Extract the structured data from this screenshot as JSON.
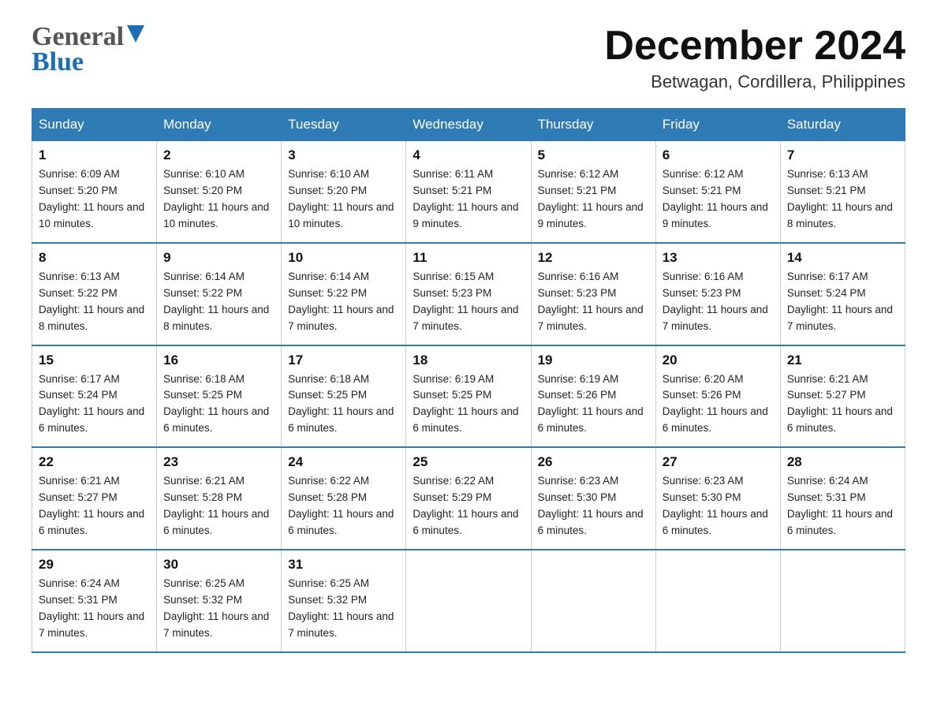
{
  "header": {
    "logo_top": "General",
    "logo_bottom": "Blue",
    "month_title": "December 2024",
    "location": "Betwagan, Cordillera, Philippines"
  },
  "days_of_week": [
    "Sunday",
    "Monday",
    "Tuesday",
    "Wednesday",
    "Thursday",
    "Friday",
    "Saturday"
  ],
  "weeks": [
    [
      {
        "day": "1",
        "sunrise": "6:09 AM",
        "sunset": "5:20 PM",
        "daylight": "11 hours and 10 minutes."
      },
      {
        "day": "2",
        "sunrise": "6:10 AM",
        "sunset": "5:20 PM",
        "daylight": "11 hours and 10 minutes."
      },
      {
        "day": "3",
        "sunrise": "6:10 AM",
        "sunset": "5:20 PM",
        "daylight": "11 hours and 10 minutes."
      },
      {
        "day": "4",
        "sunrise": "6:11 AM",
        "sunset": "5:21 PM",
        "daylight": "11 hours and 9 minutes."
      },
      {
        "day": "5",
        "sunrise": "6:12 AM",
        "sunset": "5:21 PM",
        "daylight": "11 hours and 9 minutes."
      },
      {
        "day": "6",
        "sunrise": "6:12 AM",
        "sunset": "5:21 PM",
        "daylight": "11 hours and 9 minutes."
      },
      {
        "day": "7",
        "sunrise": "6:13 AM",
        "sunset": "5:21 PM",
        "daylight": "11 hours and 8 minutes."
      }
    ],
    [
      {
        "day": "8",
        "sunrise": "6:13 AM",
        "sunset": "5:22 PM",
        "daylight": "11 hours and 8 minutes."
      },
      {
        "day": "9",
        "sunrise": "6:14 AM",
        "sunset": "5:22 PM",
        "daylight": "11 hours and 8 minutes."
      },
      {
        "day": "10",
        "sunrise": "6:14 AM",
        "sunset": "5:22 PM",
        "daylight": "11 hours and 7 minutes."
      },
      {
        "day": "11",
        "sunrise": "6:15 AM",
        "sunset": "5:23 PM",
        "daylight": "11 hours and 7 minutes."
      },
      {
        "day": "12",
        "sunrise": "6:16 AM",
        "sunset": "5:23 PM",
        "daylight": "11 hours and 7 minutes."
      },
      {
        "day": "13",
        "sunrise": "6:16 AM",
        "sunset": "5:23 PM",
        "daylight": "11 hours and 7 minutes."
      },
      {
        "day": "14",
        "sunrise": "6:17 AM",
        "sunset": "5:24 PM",
        "daylight": "11 hours and 7 minutes."
      }
    ],
    [
      {
        "day": "15",
        "sunrise": "6:17 AM",
        "sunset": "5:24 PM",
        "daylight": "11 hours and 6 minutes."
      },
      {
        "day": "16",
        "sunrise": "6:18 AM",
        "sunset": "5:25 PM",
        "daylight": "11 hours and 6 minutes."
      },
      {
        "day": "17",
        "sunrise": "6:18 AM",
        "sunset": "5:25 PM",
        "daylight": "11 hours and 6 minutes."
      },
      {
        "day": "18",
        "sunrise": "6:19 AM",
        "sunset": "5:25 PM",
        "daylight": "11 hours and 6 minutes."
      },
      {
        "day": "19",
        "sunrise": "6:19 AM",
        "sunset": "5:26 PM",
        "daylight": "11 hours and 6 minutes."
      },
      {
        "day": "20",
        "sunrise": "6:20 AM",
        "sunset": "5:26 PM",
        "daylight": "11 hours and 6 minutes."
      },
      {
        "day": "21",
        "sunrise": "6:21 AM",
        "sunset": "5:27 PM",
        "daylight": "11 hours and 6 minutes."
      }
    ],
    [
      {
        "day": "22",
        "sunrise": "6:21 AM",
        "sunset": "5:27 PM",
        "daylight": "11 hours and 6 minutes."
      },
      {
        "day": "23",
        "sunrise": "6:21 AM",
        "sunset": "5:28 PM",
        "daylight": "11 hours and 6 minutes."
      },
      {
        "day": "24",
        "sunrise": "6:22 AM",
        "sunset": "5:28 PM",
        "daylight": "11 hours and 6 minutes."
      },
      {
        "day": "25",
        "sunrise": "6:22 AM",
        "sunset": "5:29 PM",
        "daylight": "11 hours and 6 minutes."
      },
      {
        "day": "26",
        "sunrise": "6:23 AM",
        "sunset": "5:30 PM",
        "daylight": "11 hours and 6 minutes."
      },
      {
        "day": "27",
        "sunrise": "6:23 AM",
        "sunset": "5:30 PM",
        "daylight": "11 hours and 6 minutes."
      },
      {
        "day": "28",
        "sunrise": "6:24 AM",
        "sunset": "5:31 PM",
        "daylight": "11 hours and 6 minutes."
      }
    ],
    [
      {
        "day": "29",
        "sunrise": "6:24 AM",
        "sunset": "5:31 PM",
        "daylight": "11 hours and 7 minutes."
      },
      {
        "day": "30",
        "sunrise": "6:25 AM",
        "sunset": "5:32 PM",
        "daylight": "11 hours and 7 minutes."
      },
      {
        "day": "31",
        "sunrise": "6:25 AM",
        "sunset": "5:32 PM",
        "daylight": "11 hours and 7 minutes."
      },
      null,
      null,
      null,
      null
    ]
  ],
  "labels": {
    "sunrise_prefix": "Sunrise: ",
    "sunset_prefix": "Sunset: ",
    "daylight_prefix": "Daylight: "
  }
}
